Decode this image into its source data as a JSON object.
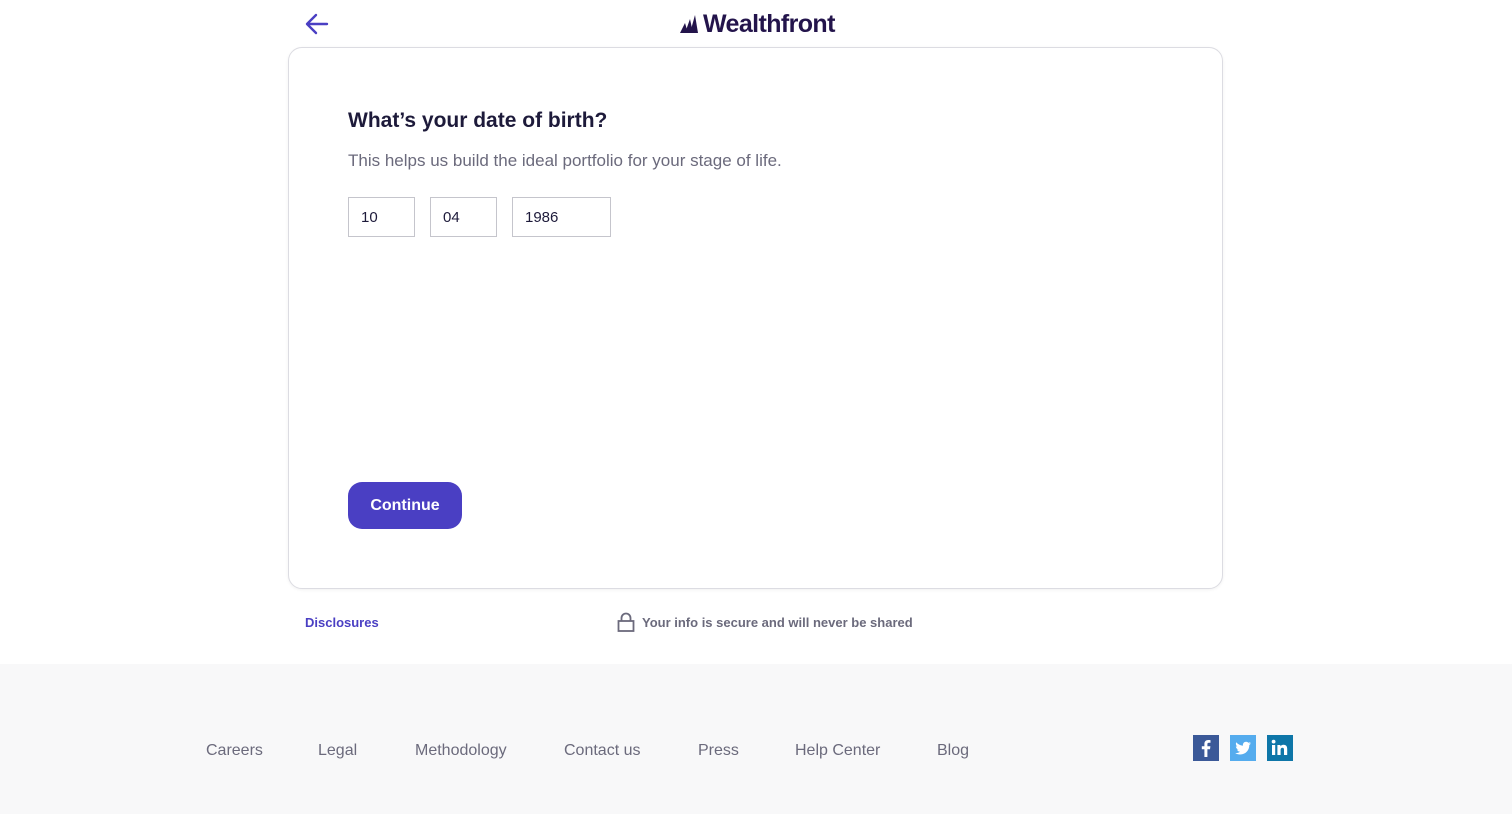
{
  "header": {
    "back_icon": "arrow-left-icon",
    "logo_text": "Wealthfront",
    "logo_icon": "wealthfront-mark-icon"
  },
  "form": {
    "title": "What’s your date of birth?",
    "subtitle": "This helps us build the ideal portfolio for your stage of life.",
    "month_value": "10",
    "day_value": "04",
    "year_value": "1986",
    "continue_label": "Continue"
  },
  "below_card": {
    "disclosures_label": "Disclosures",
    "secure_text": "Your info is secure and will never be shared",
    "lock_icon": "lock-icon"
  },
  "footer": {
    "links": [
      "Careers",
      "Legal",
      "Methodology",
      "Contact us",
      "Press",
      "Help Center",
      "Blog"
    ],
    "social": [
      "facebook-icon",
      "twitter-icon",
      "linkedin-icon"
    ]
  },
  "colors": {
    "accent": "#4a3fc3",
    "logo": "#23144b",
    "facebook": "#3b5998",
    "twitter": "#55acee",
    "linkedin": "#0e76a8",
    "footer_bg": "#f8f8f9"
  }
}
